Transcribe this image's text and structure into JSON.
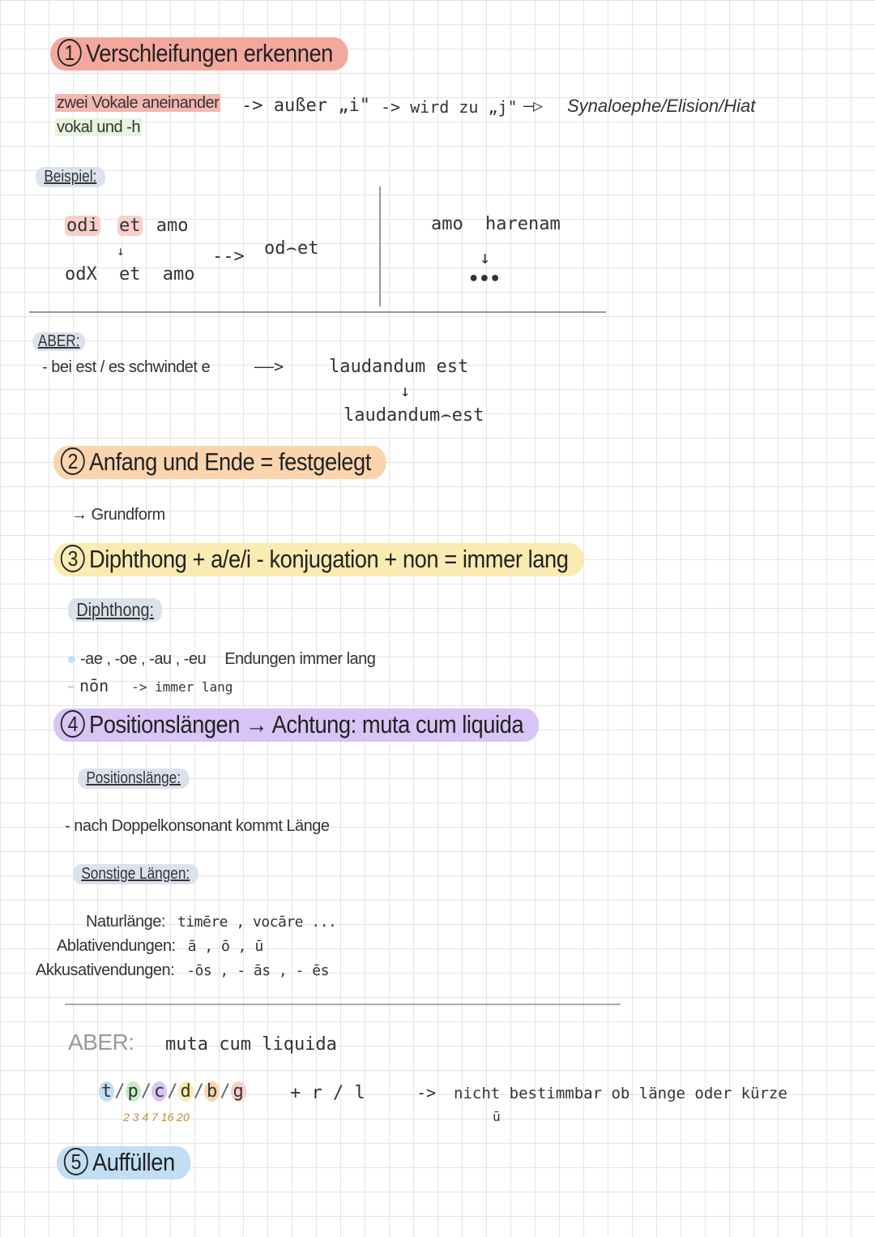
{
  "colors": {
    "red": "#f3a89e",
    "orange": "#f9d4ad",
    "yellow": "#f9ebb1",
    "purple": "#d8c4f5",
    "blue": "#c1def3",
    "grey_tag": "#dbe2ec"
  },
  "s1": {
    "num": "1",
    "title": "Verschleifungen erkennen",
    "bullet1": "zwei Vokale aneinander",
    "bullet2": "vokal und -h",
    "arrow1": "-> außer „i\"",
    "arrow2": "-> wird zu „j\"",
    "arrow3": "—▷",
    "terms": "Synaloephe/Elision/Hiat",
    "beispiel_label": "Beispiel:",
    "ex1_line1": [
      "odi",
      "et",
      "amo"
    ],
    "ex1_line2": [
      "odX",
      "et",
      "amo"
    ],
    "ex1_arrow": "-->",
    "ex1_result": "od⌢et",
    "ex2_line1": [
      "amo",
      "harenam"
    ],
    "ex2_down": "↓",
    "ex2_result": "•••",
    "aber_label": "ABER:",
    "aber_text": "- bei est / es schwindet e",
    "aber_arrow": "——>",
    "aber_ex1": "laudandum est",
    "aber_down": "↓",
    "aber_ex2": "laudandum⌢est"
  },
  "s2": {
    "num": "2",
    "title": "Anfang und Ende = festgelegt",
    "sub": "→ Grundform"
  },
  "s3": {
    "num": "3",
    "title": "Diphthong + a/e/i - konjugation + non = immer lang",
    "tag": "Diphthong:",
    "line1_a": "-ae , -oe , -au , -eu",
    "line1_b": "Endungen immer lang",
    "line2_a": "nōn",
    "line2_b": "-> immer lang"
  },
  "s4": {
    "num": "4",
    "title": "Positionslängen → Achtung: muta cum liquida",
    "tag1": "Positionslänge:",
    "line1": "- nach Doppelkonsonant kommt Länge",
    "tag2": "Sonstige Längen:",
    "row1_label": "Naturlänge:",
    "row1_val": "timēre , vocāre ...",
    "row2_label": "Ablativendungen:",
    "row2_val": "ā , ō , ū",
    "row3_label": "Akkusativendungen:",
    "row3_val": "-ōs , - ās , - ēs",
    "aber_label": "ABER:",
    "aber_text": "muta cum liquida",
    "muta": [
      "t",
      "p",
      "c",
      "d",
      "b",
      "g"
    ],
    "muta_nums": "2 3 4 7 16 20",
    "plus": "+ r / l",
    "arrow": "->",
    "result": "nicht bestimmbar ob länge oder kürze",
    "breve": "ū"
  },
  "s5": {
    "num": "5",
    "title": "Auffüllen"
  }
}
